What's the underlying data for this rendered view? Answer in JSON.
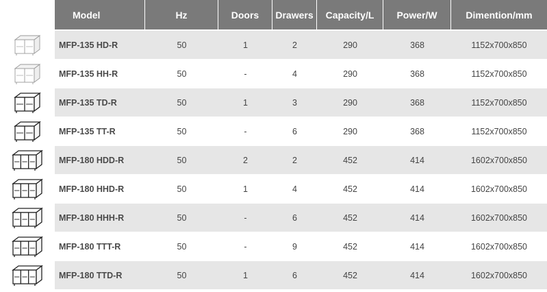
{
  "headers": {
    "model": "Model",
    "hz": "Hz",
    "doors": "Doors",
    "drawers": "Drawers",
    "capacity": "Capacity/L",
    "power": "Power/W",
    "dimension": "Dimention/mm"
  },
  "rows": [
    {
      "model": "MFP-135 HD-R",
      "hz": "50",
      "doors": "1",
      "drawers": "2",
      "capacity": "290",
      "power": "368",
      "dimension": "1152x700x850",
      "image": "two-section-counter-light-icon"
    },
    {
      "model": "MFP-135 HH-R",
      "hz": "50",
      "doors": "-",
      "drawers": "4",
      "capacity": "290",
      "power": "368",
      "dimension": "1152x700x850",
      "image": "two-section-counter-light-icon"
    },
    {
      "model": "MFP-135 TD-R",
      "hz": "50",
      "doors": "1",
      "drawers": "3",
      "capacity": "290",
      "power": "368",
      "dimension": "1152x700x850",
      "image": "two-section-counter-icon"
    },
    {
      "model": "MFP-135 TT-R",
      "hz": "50",
      "doors": "-",
      "drawers": "6",
      "capacity": "290",
      "power": "368",
      "dimension": "1152x700x850",
      "image": "two-section-counter-icon"
    },
    {
      "model": "MFP-180 HDD-R",
      "hz": "50",
      "doors": "2",
      "drawers": "2",
      "capacity": "452",
      "power": "414",
      "dimension": "1602x700x850",
      "image": "three-section-counter-icon"
    },
    {
      "model": "MFP-180 HHD-R",
      "hz": "50",
      "doors": "1",
      "drawers": "4",
      "capacity": "452",
      "power": "414",
      "dimension": "1602x700x850",
      "image": "three-section-counter-icon"
    },
    {
      "model": "MFP-180 HHH-R",
      "hz": "50",
      "doors": "-",
      "drawers": "6",
      "capacity": "452",
      "power": "414",
      "dimension": "1602x700x850",
      "image": "three-section-counter-icon"
    },
    {
      "model": "MFP-180 TTT-R",
      "hz": "50",
      "doors": "-",
      "drawers": "9",
      "capacity": "452",
      "power": "414",
      "dimension": "1602x700x850",
      "image": "three-section-counter-icon"
    },
    {
      "model": "MFP-180 TTD-R",
      "hz": "50",
      "doors": "1",
      "drawers": "6",
      "capacity": "452",
      "power": "414",
      "dimension": "1602x700x850",
      "image": "three-section-counter-icon"
    }
  ]
}
